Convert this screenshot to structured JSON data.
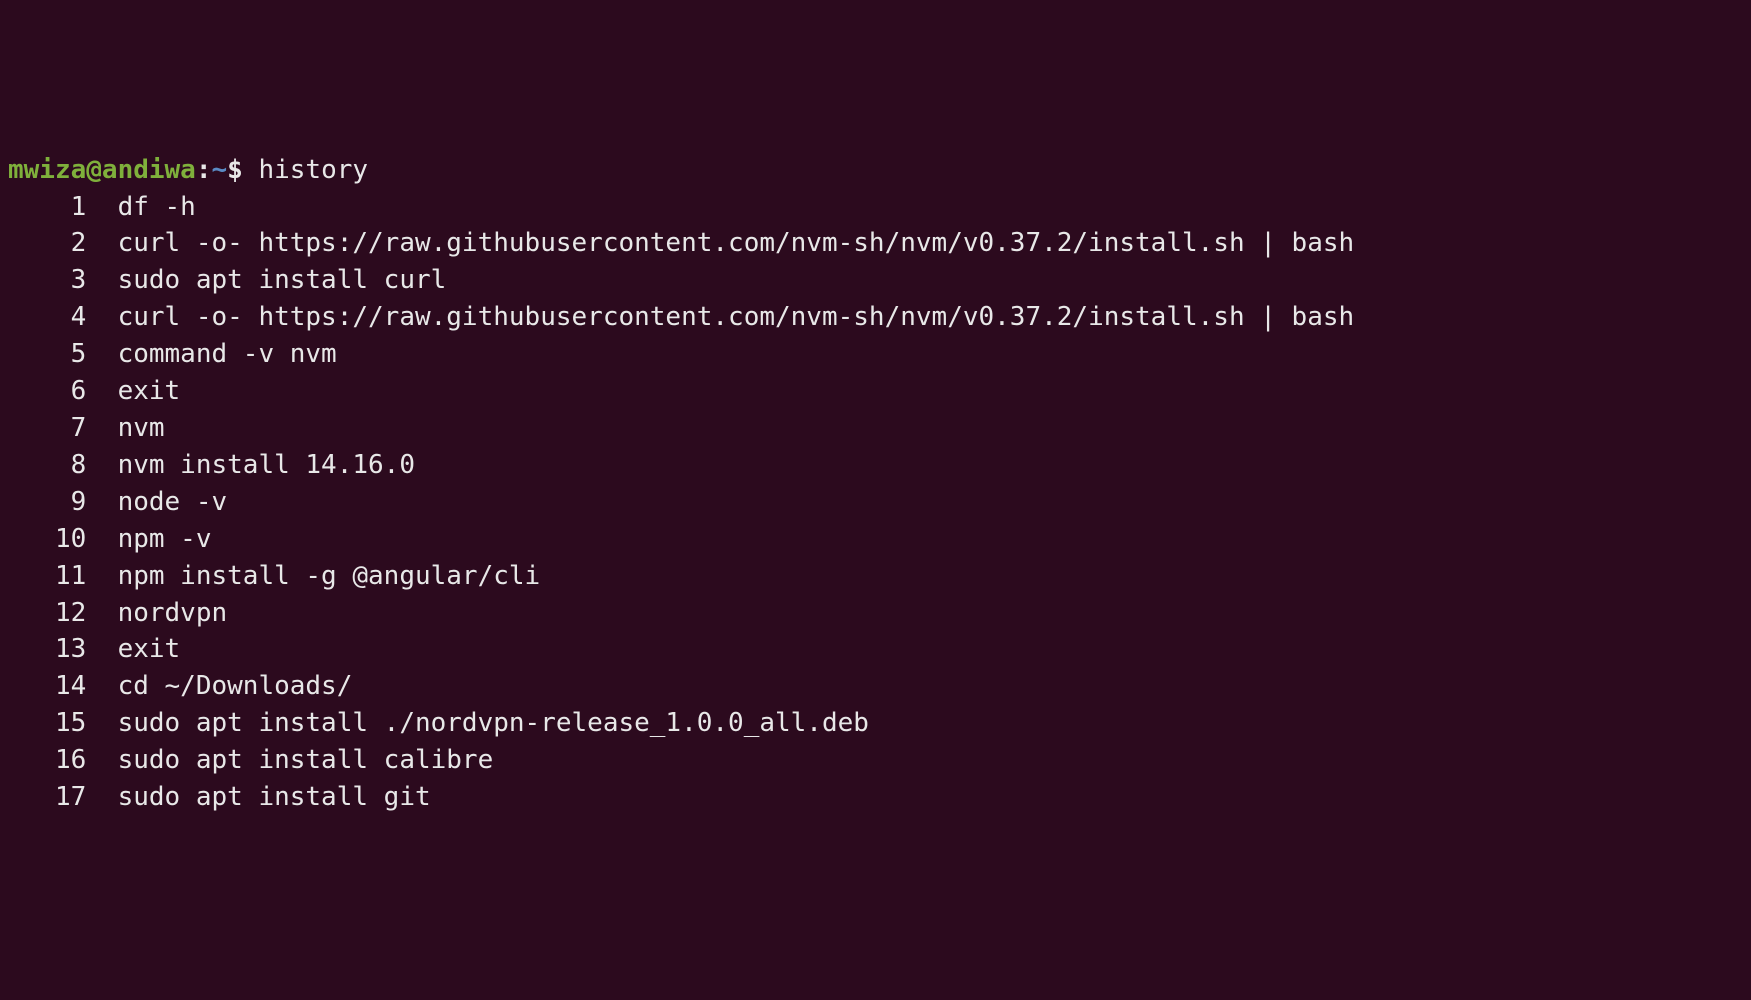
{
  "prompt": {
    "user_host": "mwiza@andiwa",
    "colon": ":",
    "path": "~",
    "dollar": "$ ",
    "command": "history"
  },
  "history": [
    {
      "n": "1",
      "cmd": "df -h"
    },
    {
      "n": "2",
      "cmd": "curl -o- https://raw.githubusercontent.com/nvm-sh/nvm/v0.37.2/install.sh | bash"
    },
    {
      "n": "3",
      "cmd": "sudo apt install curl"
    },
    {
      "n": "4",
      "cmd": "curl -o- https://raw.githubusercontent.com/nvm-sh/nvm/v0.37.2/install.sh | bash"
    },
    {
      "n": "5",
      "cmd": "command -v nvm"
    },
    {
      "n": "6",
      "cmd": "exit"
    },
    {
      "n": "7",
      "cmd": "nvm"
    },
    {
      "n": "8",
      "cmd": "nvm install 14.16.0"
    },
    {
      "n": "9",
      "cmd": "node -v"
    },
    {
      "n": "10",
      "cmd": "npm -v"
    },
    {
      "n": "11",
      "cmd": "npm install -g @angular/cli"
    },
    {
      "n": "12",
      "cmd": "nordvpn"
    },
    {
      "n": "13",
      "cmd": "exit"
    },
    {
      "n": "14",
      "cmd": "cd ~/Downloads/"
    },
    {
      "n": "15",
      "cmd": "sudo apt install ./nordvpn-release_1.0.0_all.deb"
    },
    {
      "n": "16",
      "cmd": "sudo apt install calibre"
    },
    {
      "n": "17",
      "cmd": "sudo apt install git"
    }
  ]
}
